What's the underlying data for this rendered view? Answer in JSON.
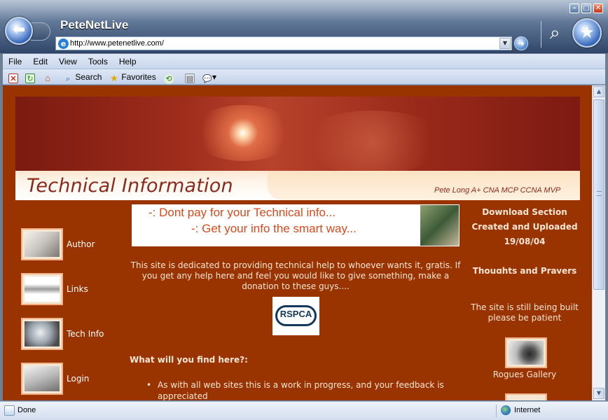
{
  "window": {
    "title": "PeteNetLive",
    "min_glyph": "–",
    "max_glyph": "□",
    "close_glyph": "✕"
  },
  "nav": {
    "back_glyph": "⬅",
    "favorites_glyph": "★",
    "search_glyph": "⌕",
    "go_glyph": "➜",
    "dropdown_glyph": "▼"
  },
  "address": {
    "url": "http://www.petenetlive.com/",
    "icon": "ie-page-icon"
  },
  "menu": [
    "File",
    "Edit",
    "View",
    "Tools",
    "Help"
  ],
  "toolbar": {
    "search_label": "Search",
    "favorites_label": "Favorites",
    "icons": [
      "stop-icon",
      "refresh-icon",
      "home-icon",
      "search-icon",
      "favorites-icon",
      "history-icon",
      "print-icon",
      "messenger-icon"
    ]
  },
  "banner": {
    "title": "Technical Information",
    "subtitle": "Pete Long A+ CNA MCP CCNA MVP"
  },
  "left_nav": [
    {
      "label": "Author",
      "icon": "pen-icon"
    },
    {
      "label": "Links",
      "icon": "chain-icon"
    },
    {
      "label": "Tech Info",
      "icon": "magnifier-icon"
    },
    {
      "label": "Login",
      "icon": "key-icon"
    }
  ],
  "ad": {
    "line1": "-: Dont pay for your Technical info...",
    "line2": "-: Get your info the smart way..."
  },
  "intro": "This site is dedicated to providing technical help to whoever wants it, gratis. If you get any help here and feel you would like to give something, make a donation to these guys....",
  "rspca": "RSPCA",
  "find": {
    "heading": "What will you find here?:",
    "items": [
      "As with all web sites this is a work in progress, and your feedback is appreciated"
    ]
  },
  "right": {
    "download_title": "Download Section",
    "created": "Created and Uploaded",
    "date": "19/08/04",
    "thoughts": "Thoughts and Prayers",
    "building": "The site is still being built please be patient",
    "rogues": "Rogues Gallery"
  },
  "status": {
    "text": "Done",
    "zone": "Internet"
  },
  "colors": {
    "page_bg": "#993300",
    "text": "#fbe6d6",
    "ad_text": "#d84a1d",
    "banner_text": "#8b2a1c"
  }
}
